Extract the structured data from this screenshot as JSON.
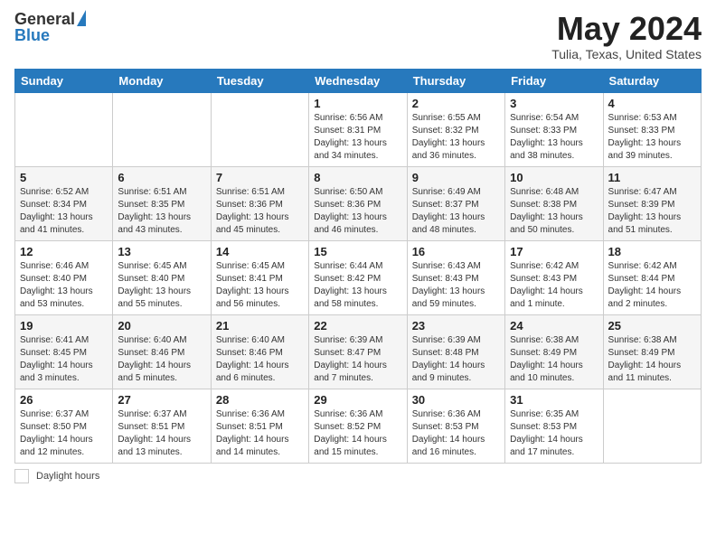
{
  "header": {
    "logo_general": "General",
    "logo_blue": "Blue",
    "month_title": "May 2024",
    "location": "Tulia, Texas, United States"
  },
  "weekdays": [
    "Sunday",
    "Monday",
    "Tuesday",
    "Wednesday",
    "Thursday",
    "Friday",
    "Saturday"
  ],
  "weeks": [
    [
      {
        "day": "",
        "info": ""
      },
      {
        "day": "",
        "info": ""
      },
      {
        "day": "",
        "info": ""
      },
      {
        "day": "1",
        "info": "Sunrise: 6:56 AM\nSunset: 8:31 PM\nDaylight: 13 hours\nand 34 minutes."
      },
      {
        "day": "2",
        "info": "Sunrise: 6:55 AM\nSunset: 8:32 PM\nDaylight: 13 hours\nand 36 minutes."
      },
      {
        "day": "3",
        "info": "Sunrise: 6:54 AM\nSunset: 8:33 PM\nDaylight: 13 hours\nand 38 minutes."
      },
      {
        "day": "4",
        "info": "Sunrise: 6:53 AM\nSunset: 8:33 PM\nDaylight: 13 hours\nand 39 minutes."
      }
    ],
    [
      {
        "day": "5",
        "info": "Sunrise: 6:52 AM\nSunset: 8:34 PM\nDaylight: 13 hours\nand 41 minutes."
      },
      {
        "day": "6",
        "info": "Sunrise: 6:51 AM\nSunset: 8:35 PM\nDaylight: 13 hours\nand 43 minutes."
      },
      {
        "day": "7",
        "info": "Sunrise: 6:51 AM\nSunset: 8:36 PM\nDaylight: 13 hours\nand 45 minutes."
      },
      {
        "day": "8",
        "info": "Sunrise: 6:50 AM\nSunset: 8:36 PM\nDaylight: 13 hours\nand 46 minutes."
      },
      {
        "day": "9",
        "info": "Sunrise: 6:49 AM\nSunset: 8:37 PM\nDaylight: 13 hours\nand 48 minutes."
      },
      {
        "day": "10",
        "info": "Sunrise: 6:48 AM\nSunset: 8:38 PM\nDaylight: 13 hours\nand 50 minutes."
      },
      {
        "day": "11",
        "info": "Sunrise: 6:47 AM\nSunset: 8:39 PM\nDaylight: 13 hours\nand 51 minutes."
      }
    ],
    [
      {
        "day": "12",
        "info": "Sunrise: 6:46 AM\nSunset: 8:40 PM\nDaylight: 13 hours\nand 53 minutes."
      },
      {
        "day": "13",
        "info": "Sunrise: 6:45 AM\nSunset: 8:40 PM\nDaylight: 13 hours\nand 55 minutes."
      },
      {
        "day": "14",
        "info": "Sunrise: 6:45 AM\nSunset: 8:41 PM\nDaylight: 13 hours\nand 56 minutes."
      },
      {
        "day": "15",
        "info": "Sunrise: 6:44 AM\nSunset: 8:42 PM\nDaylight: 13 hours\nand 58 minutes."
      },
      {
        "day": "16",
        "info": "Sunrise: 6:43 AM\nSunset: 8:43 PM\nDaylight: 13 hours\nand 59 minutes."
      },
      {
        "day": "17",
        "info": "Sunrise: 6:42 AM\nSunset: 8:43 PM\nDaylight: 14 hours\nand 1 minute."
      },
      {
        "day": "18",
        "info": "Sunrise: 6:42 AM\nSunset: 8:44 PM\nDaylight: 14 hours\nand 2 minutes."
      }
    ],
    [
      {
        "day": "19",
        "info": "Sunrise: 6:41 AM\nSunset: 8:45 PM\nDaylight: 14 hours\nand 3 minutes."
      },
      {
        "day": "20",
        "info": "Sunrise: 6:40 AM\nSunset: 8:46 PM\nDaylight: 14 hours\nand 5 minutes."
      },
      {
        "day": "21",
        "info": "Sunrise: 6:40 AM\nSunset: 8:46 PM\nDaylight: 14 hours\nand 6 minutes."
      },
      {
        "day": "22",
        "info": "Sunrise: 6:39 AM\nSunset: 8:47 PM\nDaylight: 14 hours\nand 7 minutes."
      },
      {
        "day": "23",
        "info": "Sunrise: 6:39 AM\nSunset: 8:48 PM\nDaylight: 14 hours\nand 9 minutes."
      },
      {
        "day": "24",
        "info": "Sunrise: 6:38 AM\nSunset: 8:49 PM\nDaylight: 14 hours\nand 10 minutes."
      },
      {
        "day": "25",
        "info": "Sunrise: 6:38 AM\nSunset: 8:49 PM\nDaylight: 14 hours\nand 11 minutes."
      }
    ],
    [
      {
        "day": "26",
        "info": "Sunrise: 6:37 AM\nSunset: 8:50 PM\nDaylight: 14 hours\nand 12 minutes."
      },
      {
        "day": "27",
        "info": "Sunrise: 6:37 AM\nSunset: 8:51 PM\nDaylight: 14 hours\nand 13 minutes."
      },
      {
        "day": "28",
        "info": "Sunrise: 6:36 AM\nSunset: 8:51 PM\nDaylight: 14 hours\nand 14 minutes."
      },
      {
        "day": "29",
        "info": "Sunrise: 6:36 AM\nSunset: 8:52 PM\nDaylight: 14 hours\nand 15 minutes."
      },
      {
        "day": "30",
        "info": "Sunrise: 6:36 AM\nSunset: 8:53 PM\nDaylight: 14 hours\nand 16 minutes."
      },
      {
        "day": "31",
        "info": "Sunrise: 6:35 AM\nSunset: 8:53 PM\nDaylight: 14 hours\nand 17 minutes."
      },
      {
        "day": "",
        "info": ""
      }
    ]
  ],
  "legend": {
    "box_label": "",
    "text": "Daylight hours"
  }
}
